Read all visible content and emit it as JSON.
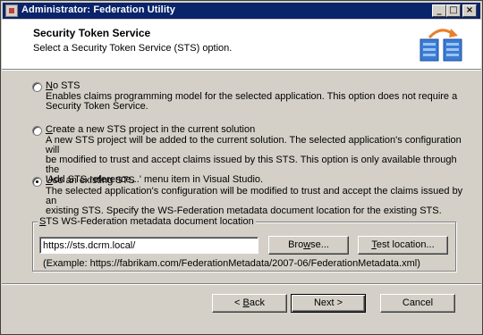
{
  "window": {
    "title": "Administrator: Federation Utility",
    "caption_buttons": {
      "minimize": "_",
      "maximize": "□",
      "close": "×"
    }
  },
  "header": {
    "title": "Security Token Service",
    "subtitle": "Select a Security Token Service (STS) option.",
    "icon": "sts-wizard-icon"
  },
  "options": [
    {
      "key": "N",
      "label_rest": "o STS",
      "selected": false,
      "description": [
        "Enables claims programming model for the selected application. This option does not require a",
        "Security Token Service."
      ]
    },
    {
      "key": "C",
      "label_rest": "reate a new STS project in the current solution",
      "selected": false,
      "description": [
        "A new STS project will be added to the current solution. The selected application's configuration will",
        "be modified to trust and accept claims issued by this STS. This option is only available through the",
        "'Add STS reference...' menu item in Visual Studio."
      ]
    },
    {
      "key": "U",
      "label_rest": "se an existing STS",
      "selected": true,
      "description": [
        "The selected application's configuration will be modified to trust and accept the claims issued by an",
        "existing STS. Specify the WS-Federation metadata document location for the existing STS."
      ]
    }
  ],
  "metadata": {
    "legend_key": "S",
    "legend_rest": "TS WS-Federation metadata document location",
    "url_value": "https://sts.dcrm.local/",
    "browse_key": "w",
    "browse_pre": "Bro",
    "browse_post": "se...",
    "test_key": "T",
    "test_rest": "est location...",
    "example": "(Example: https://fabrikam.com/FederationMetadata/2007-06/FederationMetadata.xml)"
  },
  "footer": {
    "back_prefix": "< ",
    "back_key": "B",
    "back_rest": "ack",
    "next_label": "Next >",
    "cancel_label": "Cancel"
  }
}
